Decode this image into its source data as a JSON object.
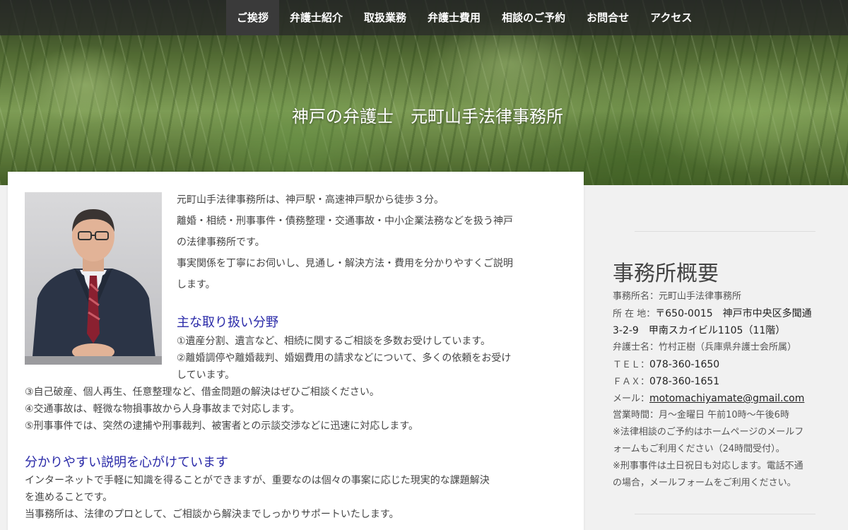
{
  "nav": {
    "items": [
      {
        "label": "ご挨拶"
      },
      {
        "label": "弁護士紹介"
      },
      {
        "label": "取扱業務"
      },
      {
        "label": "弁護士費用"
      },
      {
        "label": "相談のご予約"
      },
      {
        "label": "お問合せ"
      },
      {
        "label": "アクセス"
      }
    ],
    "active_index": 0
  },
  "hero": {
    "title": "神戸の弁護士　元町山手法律事務所"
  },
  "main": {
    "intro": [
      "元町山手法律事務所は、神戸駅・高速神戸駅から徒歩３分。",
      "離婚・相続・刑事事件・債務整理・交通事故・中小企業法務などを扱う神戸",
      "の法律事務所です。",
      "事実関係を丁寧にお伺いし、見通し・解決方法・費用を分かりやすくご説明",
      "します。"
    ],
    "areas_heading": "主な取り扱い分野",
    "areas": [
      "①遺産分割、遺言など、相続に関するご相談を多数お受けしています。",
      "②離婚調停や離婚裁判、婚姻費用の請求などについて、多くの依頼をお受け",
      "しています。",
      "③自己破産、個人再生、任意整理など、借金問題の解決はぜひご相談ください。",
      "④交通事故は、軽微な物損事故から人身事故まで対応します。",
      "⑤刑事事件では、突然の逮捕や刑事裁判、被害者との示談交渉などに迅速に対応します。"
    ],
    "explain_heading": "分かりやすい説明を心がけています",
    "explain": [
      "インターネットで手軽に知識を得ることができますが、重要なのは個々の事案に応じた現実的な課題解決",
      "を進めることです。",
      "当事務所は、法律のプロとして、ご相談から解決までしっかりサポートいたします。"
    ]
  },
  "sidebar": {
    "title": "事務所概要",
    "office_name": "事務所名：元町山手法律事務所",
    "address_label": "所 在 地：",
    "address_1": "〒650-0015　神戸市中央区多聞通",
    "address_2": "3-2-9　甲南スカイビル1105（11階）",
    "lawyer": "弁護士名：竹村正樹（兵庫県弁護士会所属）",
    "tel_label": "ＴＥＬ：",
    "tel": "078-360-1650",
    "fax_label": "ＦＡＸ：",
    "fax": "078-360-1651",
    "mail_label": "メール：",
    "mail": "motomachiyamate@gmail.com",
    "hours": "営業時間：月～金曜日 午前10時～午後6時",
    "note_1a": "※法律相談のご予約はホームページのメールフ",
    "note_1b": "ォームもご利用ください（24時間受付）。",
    "note_2a": "※刑事事件は土日祝日も対応します。電話不通",
    "note_2b": "の場合，メールフォームをご利用ください。"
  }
}
